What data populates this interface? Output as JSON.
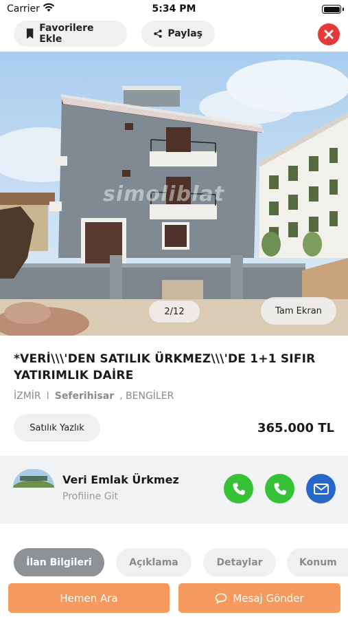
{
  "status_bar": {
    "carrier": "Carrier",
    "time": "5:34 PM"
  },
  "top_bar": {
    "favorite_label": "Favorilere Ekle",
    "share_label": "Paylaş",
    "close_color": "#e43a3a"
  },
  "gallery": {
    "watermark": "simoliblat",
    "counter": "2/12",
    "fullscreen_label": "Tam Ekran"
  },
  "listing": {
    "title": "*VERİ\\\\\\'DEN SATILIK ÜRKMEZ\\\\\\'DE 1+1 SIFIR YATIRIMLIK DAİRE",
    "city": "İZMİR",
    "separator": "I",
    "district": "Seferihisar",
    "neighborhood": ", BENGİLER",
    "type": "Satılık Yazlık",
    "price": "365.000 TL"
  },
  "agent": {
    "name": "Veri Emlak Ürkmez",
    "link": "Profiline Git",
    "icons": [
      "phone-icon",
      "phone-icon",
      "mail-icon"
    ],
    "call_color": "#36c136",
    "mail_color": "#2667c9"
  },
  "tabs": [
    {
      "label": "İlan Bilgileri",
      "active": true
    },
    {
      "label": "Açıklama",
      "active": false
    },
    {
      "label": "Detaylar",
      "active": false
    },
    {
      "label": "Konum",
      "active": false
    }
  ],
  "bottom_bar": {
    "call_label": "Hemen Ara",
    "message_label": "Mesaj Gönder",
    "accent_color": "#f49a5e"
  }
}
